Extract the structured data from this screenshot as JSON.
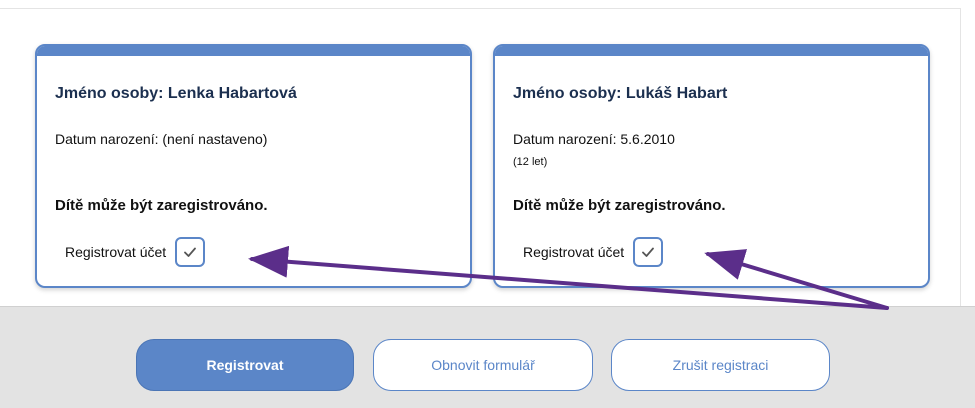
{
  "persons": [
    {
      "name_line": "Jméno osoby: Lenka Habartová",
      "birth_line": "Datum narození: (není nastaveno)",
      "age": "",
      "status": "Dítě může být zaregistrováno.",
      "register_label": "Registrovat účet",
      "register_checked": true
    },
    {
      "name_line": "Jméno osoby: Lukáš Habart",
      "birth_line": "Datum narození: 5.6.2010",
      "age": "(12 let)",
      "status": "Dítě může být zaregistrováno.",
      "register_label": "Registrovat účet",
      "register_checked": true
    }
  ],
  "actions": {
    "register": "Registrovat",
    "reset": "Obnovit formulář",
    "cancel": "Zrušit registraci"
  },
  "colors": {
    "accent": "#5b86c8",
    "annotation_arrow": "#5b2e8a",
    "footer_bg": "#e3e3e3"
  },
  "icons": {
    "checkbox": "checkmark-icon"
  }
}
